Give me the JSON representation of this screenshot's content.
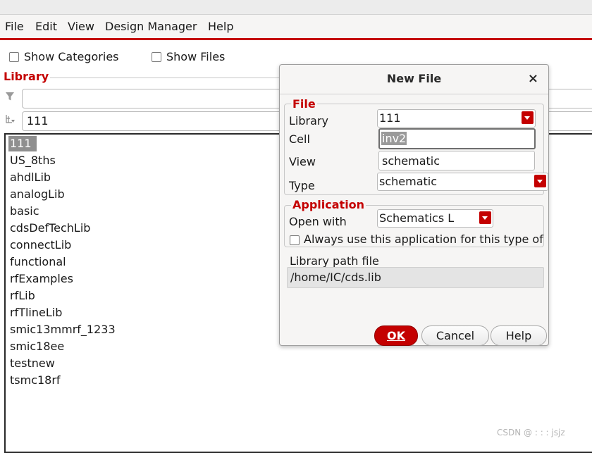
{
  "menu": {
    "file": "File",
    "edit": "Edit",
    "view": "View",
    "design_manager": "Design Manager",
    "help": "Help"
  },
  "options": {
    "show_categories": "Show Categories",
    "show_files": "Show Files"
  },
  "library": {
    "heading": "Library",
    "filter_value": "",
    "name_value": "111",
    "items": [
      "111",
      "US_8ths",
      "ahdlLib",
      "analogLib",
      "basic",
      "cdsDefTechLib",
      "connectLib",
      "functional",
      "rfExamples",
      "rfLib",
      "rfTlineLib",
      "smic13mmrf_1233",
      "smic18ee",
      "testnew",
      "tsmc18rf"
    ],
    "selected_index": 0
  },
  "dialog": {
    "title": "New File",
    "close": "×",
    "file_group": {
      "title": "File",
      "library_label": "Library",
      "library_value": "111",
      "cell_label": "Cell",
      "cell_value": "inv2",
      "view_label": "View",
      "view_value": "schematic",
      "type_label": "Type",
      "type_value": "schematic"
    },
    "application_group": {
      "title": "Application",
      "open_with_label": "Open with",
      "open_with_value": "Schematics L",
      "always_use_label": "Always use this application for this type of f"
    },
    "library_path": {
      "label": "Library path file",
      "value": "/home/IC/cds.lib"
    },
    "buttons": {
      "ok": "OK",
      "cancel": "Cancel",
      "help": "Help"
    }
  },
  "watermark": "CSDN @ :  :  : jsjz",
  "colors": {
    "accent": "#c40000",
    "selection": "#8f8f8f"
  },
  "icons": {
    "filter": "funnel-icon",
    "browse": "tree-browse-icon"
  }
}
